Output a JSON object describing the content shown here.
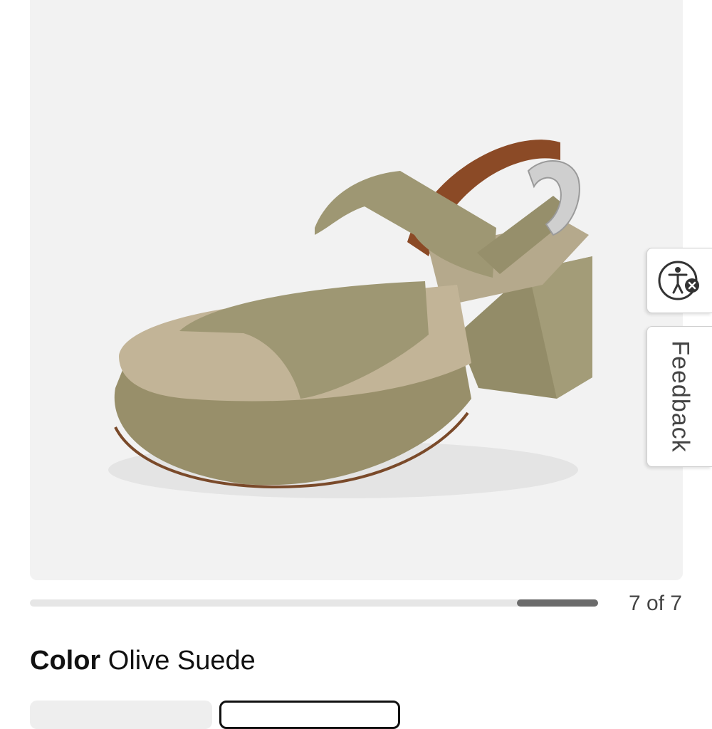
{
  "gallery": {
    "image_alt": "Olive suede platform slingback sandal with silver buckle",
    "current_slide": 7,
    "total_slides": 7,
    "counter_text": "7 of 7",
    "progress_fraction": 1.0
  },
  "color": {
    "label": "Color",
    "value": "Olive Suede"
  },
  "side_widgets": {
    "accessibility_icon": "accessibility-icon",
    "feedback_label": "Feedback"
  },
  "colors": {
    "gallery_bg": "#f2f2f2",
    "suede": "#9b9470",
    "lining": "#8b4a26",
    "buckle": "#c8c8c8"
  }
}
